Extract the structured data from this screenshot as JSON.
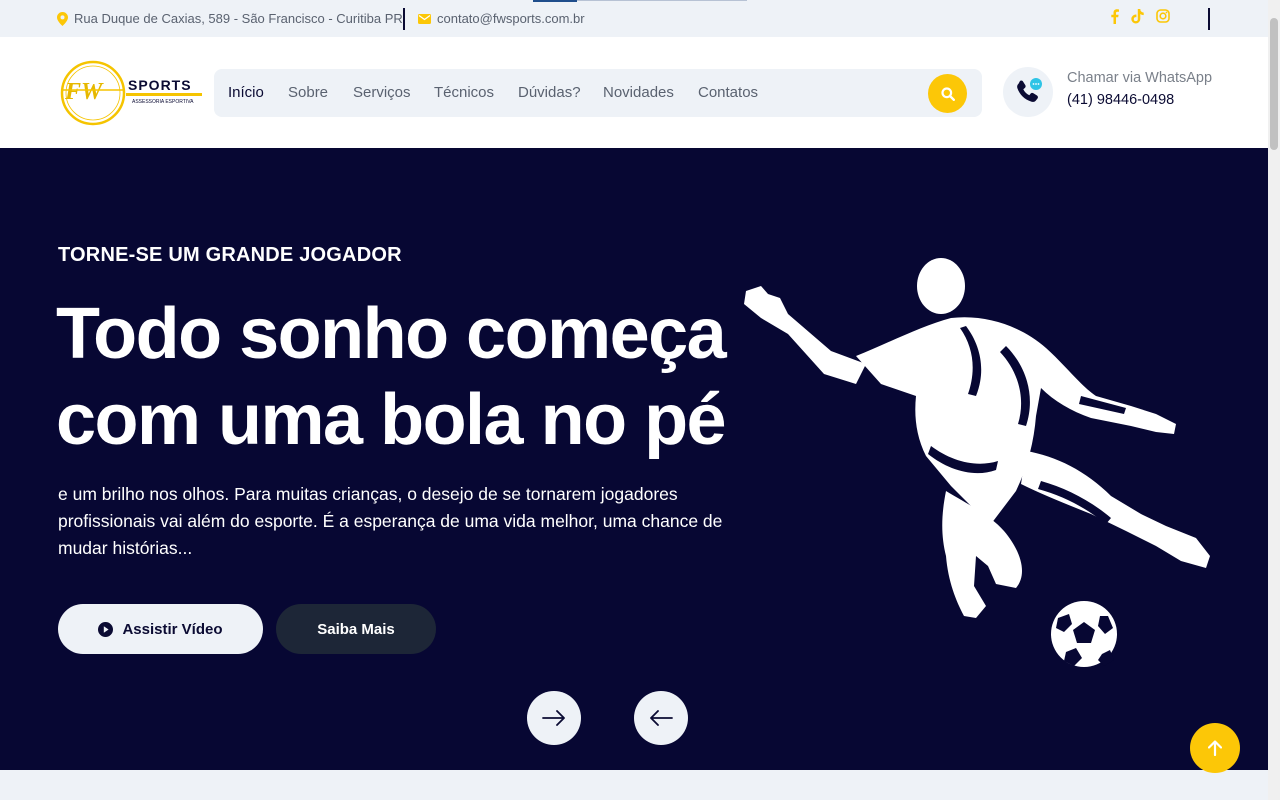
{
  "colors": {
    "accent": "#fcc707",
    "navy": "#070733",
    "light": "#eef2f7",
    "dark_button": "#1d2637"
  },
  "topbar": {
    "address": "Rua Duque de Caxias, 589 - São Francisco - Curitiba PR",
    "email": "contato@fwsports.com.br",
    "social_icons": [
      "facebook-icon",
      "tiktok-icon",
      "instagram-icon"
    ]
  },
  "header": {
    "logo_text": "SPORTS",
    "logo_subtext": "ASSESSORIA ESPORTIVA",
    "logo_mark": "FW",
    "nav": [
      {
        "label": "Início",
        "active": true
      },
      {
        "label": "Sobre"
      },
      {
        "label": "Serviços"
      },
      {
        "label": "Técnicos"
      },
      {
        "label": "Dúvidas?"
      },
      {
        "label": "Novidades"
      },
      {
        "label": "Contatos"
      }
    ],
    "whatsapp_label": "Chamar via WhatsApp",
    "whatsapp_phone": "(41) 98446-0498"
  },
  "hero": {
    "eyebrow": "TORNE-SE UM GRANDE JOGADOR",
    "headline_line1": "Todo sonho começa",
    "headline_line2": "com uma bola no pé",
    "lead": "e um brilho nos olhos. Para muitas crianças, o desejo de se tornarem jogadores profissionais vai além do esporte. É a esperança de uma vida melhor, uma chance de mudar histórias...",
    "btn_video": "Assistir Vídeo",
    "btn_more": "Saiba Mais"
  }
}
